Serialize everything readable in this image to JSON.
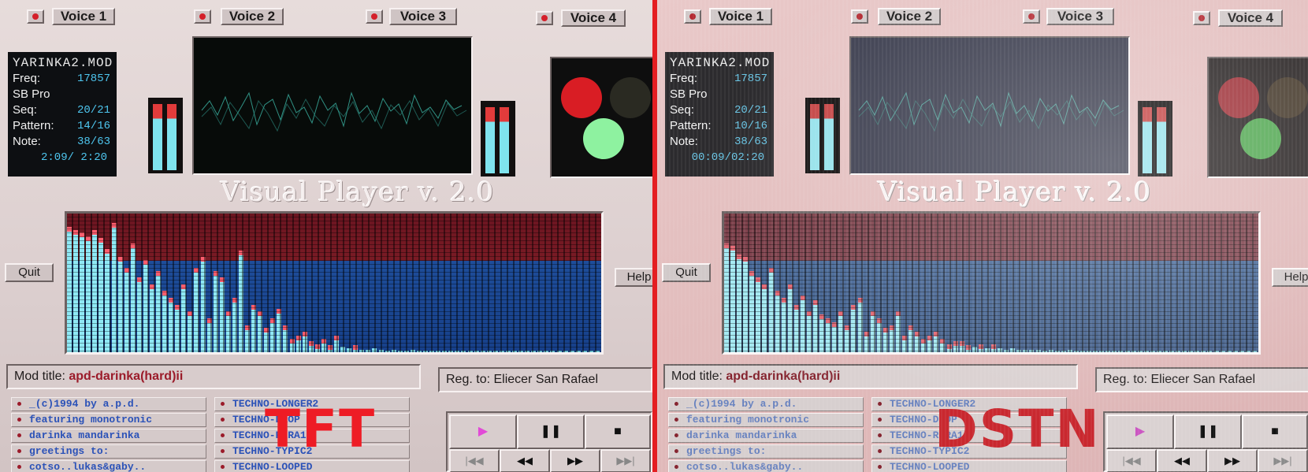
{
  "panels": [
    {
      "id": "tft",
      "caption": "TFT",
      "voices": [
        "Voice 1",
        "Voice 2",
        "Voice 3",
        "Voice 4"
      ],
      "info": {
        "filename": "YARINKA2.MOD",
        "freq_label": "Freq:",
        "freq_value": "17857",
        "card": "SB Pro",
        "seq_label": "Seq:",
        "seq_value": "20/21",
        "pattern_label": "Pattern:",
        "pattern_value": "14/16",
        "note_label": "Note:",
        "note_value": "38/63",
        "time": "2:09/ 2:20"
      },
      "lights": {
        "red": "#d91d24",
        "amber": "#2a2a22",
        "green": "#8ef2a0"
      },
      "product_title": "Visual Player  v. 2.0",
      "quit_label": "Quit",
      "help_label": "Help",
      "mod_title_label": "Mod title:",
      "mod_title_value": "apd-darinka(hard)ii",
      "reg_to": "Reg. to: Eliecer San Rafael",
      "left_list": [
        "_(c)1994 by a.p.d.",
        "featuring monotronic",
        "darinka mandarinka",
        "greetings to:",
        "cotso..lukas&gaby.."
      ],
      "right_list": [
        "TECHNO-LONGER2",
        "TECHNO-DROP",
        "TECHNO-RERA1",
        "TECHNO-TYPIC2",
        "TECHNO-LOOPED"
      ],
      "transport": {
        "play": "▶",
        "pause": "❚❚",
        "stop": "■",
        "first": "|◀◀",
        "rewind": "◀◀",
        "forward": "▶▶",
        "last": "▶▶|"
      },
      "spectrum_levels": [
        0.92,
        0.9,
        0.88,
        0.85,
        0.9,
        0.84,
        0.76,
        0.95,
        0.7,
        0.62,
        0.8,
        0.55,
        0.68,
        0.5,
        0.6,
        0.45,
        0.4,
        0.35,
        0.5,
        0.3,
        0.62,
        0.7,
        0.25,
        0.6,
        0.55,
        0.3,
        0.4,
        0.75,
        0.2,
        0.35,
        0.3,
        0.18,
        0.25,
        0.32,
        0.2,
        0.1,
        0.12,
        0.15,
        0.08,
        0.06,
        0.1,
        0.05,
        0.12,
        0.04,
        0.03,
        0.05,
        0.02,
        0.02,
        0.03,
        0.02,
        0.01,
        0.02,
        0.01,
        0.01,
        0.02,
        0.01,
        0.01,
        0.01,
        0.01,
        0.01,
        0.01,
        0.01,
        0.01,
        0.01,
        0.01,
        0.01,
        0.01,
        0.01,
        0.01,
        0.01,
        0.01,
        0.01,
        0.01,
        0.01,
        0.01,
        0.01,
        0.01,
        0.01,
        0.01,
        0.01,
        0.01,
        0.01,
        0.01,
        0.01
      ]
    },
    {
      "id": "dstn",
      "caption": "DSTN",
      "voices": [
        "Voice 1",
        "Voice 2",
        "Voice 3",
        "Voice 4"
      ],
      "info": {
        "filename": "YARINKA2.MOD",
        "freq_label": "Freq:",
        "freq_value": "17857",
        "card": "SB Pro",
        "seq_label": "Seq:",
        "seq_value": "20/21",
        "pattern_label": "Pattern:",
        "pattern_value": "10/16",
        "note_label": "Note:",
        "note_value": "38/63",
        "time": "00:09/02:20"
      },
      "lights": {
        "red": "#b82a33",
        "amber": "#4a3a28",
        "green": "#3fae3f"
      },
      "product_title": "Visual Player  v. 2.0",
      "quit_label": "Quit",
      "help_label": "Help",
      "mod_title_label": "Mod title:",
      "mod_title_value": "apd-darinka(hard)ii",
      "reg_to": "Reg. to: Eliecer San Rafael",
      "left_list": [
        "_(c)1994 by a.p.d.",
        "featuring monotronic",
        "darinka mandarinka",
        "greetings to:",
        "cotso..lukas&gaby.."
      ],
      "right_list": [
        "TECHNO-LONGER2",
        "TECHNO-DROP",
        "TECHNO-RERA1",
        "TECHNO-TYPIC2",
        "TECHNO-LOOPED"
      ],
      "transport": {
        "play": "▶",
        "pause": "❚❚",
        "stop": "■",
        "first": "|◀◀",
        "rewind": "◀◀",
        "forward": "▶▶",
        "last": "▶▶|"
      },
      "spectrum_levels": [
        0.8,
        0.78,
        0.72,
        0.7,
        0.6,
        0.55,
        0.5,
        0.62,
        0.45,
        0.4,
        0.5,
        0.35,
        0.42,
        0.3,
        0.38,
        0.28,
        0.25,
        0.22,
        0.3,
        0.2,
        0.35,
        0.4,
        0.15,
        0.3,
        0.25,
        0.18,
        0.2,
        0.3,
        0.12,
        0.2,
        0.15,
        0.1,
        0.12,
        0.15,
        0.1,
        0.06,
        0.08,
        0.08,
        0.05,
        0.04,
        0.06,
        0.03,
        0.06,
        0.03,
        0.02,
        0.03,
        0.02,
        0.02,
        0.02,
        0.02,
        0.01,
        0.02,
        0.01,
        0.01,
        0.02,
        0.01,
        0.01,
        0.01,
        0.01,
        0.01,
        0.01,
        0.01,
        0.01,
        0.01,
        0.01,
        0.01,
        0.01,
        0.01,
        0.01,
        0.01,
        0.01,
        0.01,
        0.01,
        0.01,
        0.01,
        0.01,
        0.01,
        0.01,
        0.01,
        0.01,
        0.01,
        0.01,
        0.01,
        0.01
      ]
    }
  ]
}
